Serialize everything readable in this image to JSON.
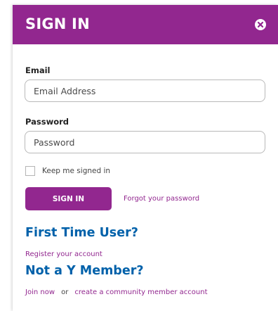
{
  "modal": {
    "title": "SIGN IN"
  },
  "form": {
    "email_label": "Email",
    "email_placeholder": "Email Address",
    "password_label": "Password",
    "password_placeholder": "Password",
    "remember_label": "Keep me signed in",
    "signin_button": "SIGN IN",
    "forgot_link": "Forgot your password"
  },
  "first_time": {
    "heading": "First Time User?",
    "register_link": "Register your account"
  },
  "not_member": {
    "heading": "Not a Y Member?",
    "join_link": "Join now",
    "or_text": "or",
    "community_link": "create a community member account"
  },
  "icons": {
    "close": "close-icon",
    "checkbox": "checkbox-icon"
  },
  "colors": {
    "brand_purple": "#92278f",
    "heading_blue": "#0061aa"
  }
}
